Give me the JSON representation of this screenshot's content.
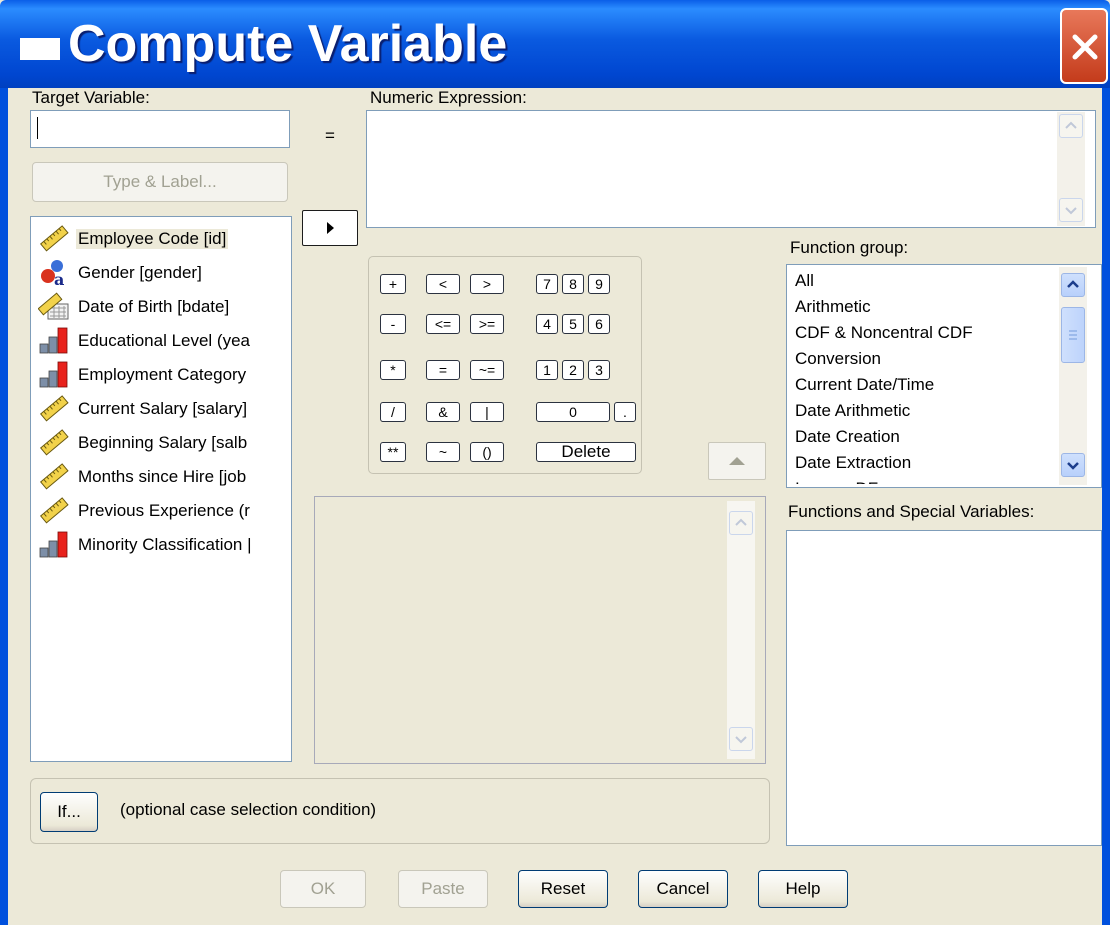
{
  "window": {
    "title": "Compute Variable"
  },
  "target": {
    "label": "Target Variable:",
    "value": "",
    "type_label_button": "Type & Label..."
  },
  "equals": "=",
  "expression": {
    "label": "Numeric Expression:",
    "value": ""
  },
  "variables": [
    {
      "label": "Employee Code [id]",
      "icon": "scale-ruler-icon",
      "selected": true
    },
    {
      "label": "Gender [gender]",
      "icon": "nominal-string-icon"
    },
    {
      "label": "Date of Birth [bdate]",
      "icon": "date-scale-icon"
    },
    {
      "label": "Educational Level (yea",
      "icon": "ordinal-bar-icon"
    },
    {
      "label": "Employment Category",
      "icon": "ordinal-bar-icon"
    },
    {
      "label": "Current Salary [salary]",
      "icon": "scale-ruler-icon"
    },
    {
      "label": "Beginning Salary [salb",
      "icon": "scale-ruler-icon"
    },
    {
      "label": "Months since Hire [job",
      "icon": "scale-ruler-icon"
    },
    {
      "label": "Previous Experience (r",
      "icon": "scale-ruler-icon"
    },
    {
      "label": "Minority Classification |",
      "icon": "ordinal-bar-icon"
    }
  ],
  "calculator": {
    "plus": "+",
    "lt": "<",
    "gt": ">",
    "minus": "-",
    "le": "<=",
    "ge": ">=",
    "mult": "*",
    "eq": "=",
    "ne": "~=",
    "div": "/",
    "and": "&",
    "or": "|",
    "pow": "**",
    "not": "~",
    "paren": "()",
    "d7": "7",
    "d8": "8",
    "d9": "9",
    "d4": "4",
    "d5": "5",
    "d6": "6",
    "d1": "1",
    "d2": "2",
    "d3": "3",
    "d0": "0",
    "dot": ".",
    "delete": "Delete"
  },
  "function_group": {
    "label": "Function group:",
    "items": [
      "All",
      "Arithmetic",
      "CDF & Noncentral CDF",
      "Conversion",
      "Current Date/Time",
      "Date Arithmetic",
      "Date Creation",
      "Date Extraction",
      "Inverse DF"
    ]
  },
  "functions_special": {
    "label": "Functions and Special Variables:"
  },
  "if_section": {
    "button": "If...",
    "text": "(optional case selection condition)"
  },
  "buttons": {
    "ok": "OK",
    "paste": "Paste",
    "reset": "Reset",
    "cancel": "Cancel",
    "help": "Help"
  }
}
